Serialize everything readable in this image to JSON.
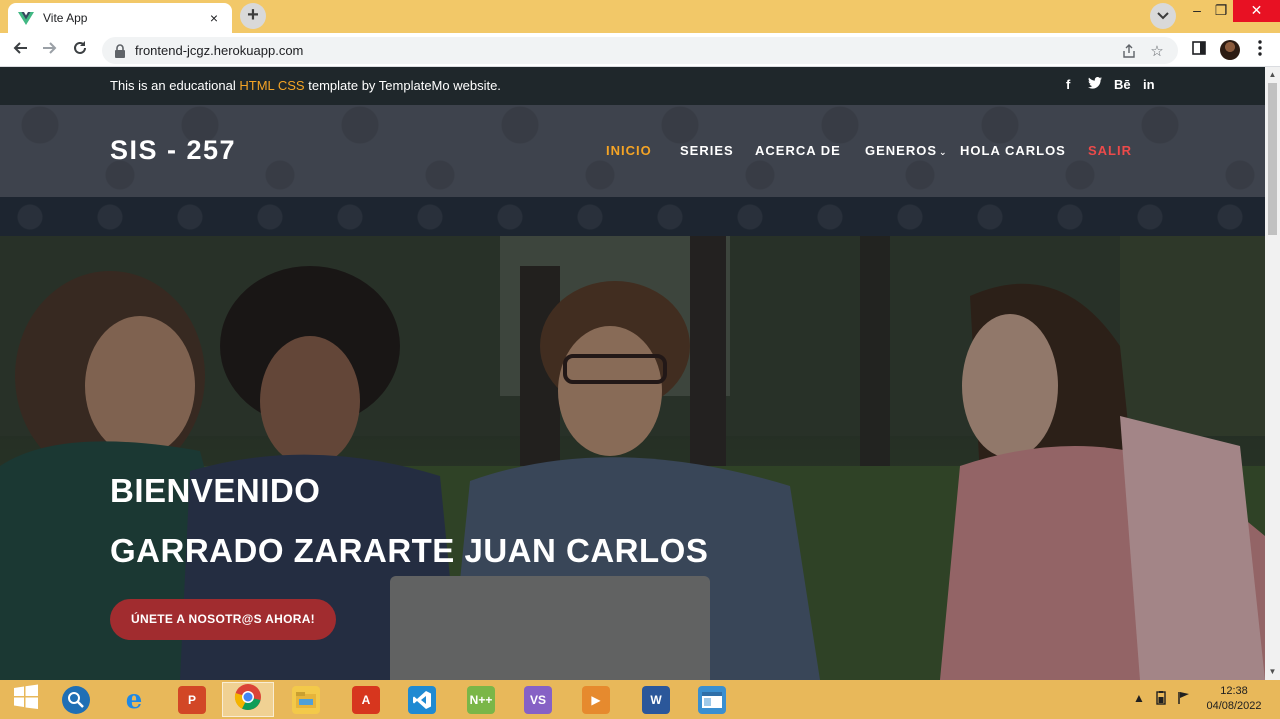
{
  "browser": {
    "tab_title": "Vite App",
    "tab_close": "×",
    "new_tab": "+",
    "url": "frontend-jcgz.herokuapp.com",
    "win_minimize": "–",
    "win_restore": "❐",
    "win_close": "✕"
  },
  "sub_header": {
    "text_before": "This is an educational ",
    "text_highlight": "HTML CSS",
    "text_after": " template by TemplateMo website.",
    "social": [
      "f",
      "t",
      "Bē",
      "in"
    ]
  },
  "header": {
    "logo": "SIS - 257",
    "nav": [
      {
        "label": "INICIO"
      },
      {
        "label": "SERIES"
      },
      {
        "label": "ACERCA DE"
      },
      {
        "label": "GENEROS"
      },
      {
        "label": "HOLA CARLOS"
      },
      {
        "label": "SALIR"
      }
    ],
    "caret": "⌄"
  },
  "hero": {
    "title_line1": "BIENVENIDO",
    "title_line2": "GARRADO ZARARTE JUAN CARLOS",
    "cta_label": "ÚNETE A NOSOTR@S AHORA!"
  },
  "taskbar": {
    "apps": [
      {
        "icon": "start-icon"
      },
      {
        "icon": "search-magnifier-icon"
      },
      {
        "icon": "internet-explorer-icon"
      },
      {
        "icon": "powerpoint-icon"
      },
      {
        "icon": "chrome-icon"
      },
      {
        "icon": "file-explorer-icon"
      },
      {
        "icon": "acrobat-icon"
      },
      {
        "icon": "vscode-icon"
      },
      {
        "icon": "notepadpp-icon"
      },
      {
        "icon": "visual-studio-icon"
      },
      {
        "icon": "media-player-icon"
      },
      {
        "icon": "word-icon"
      },
      {
        "icon": "window-app-icon"
      }
    ],
    "time": "12:38",
    "date": "04/08/2022"
  },
  "colors": {
    "accent_orange": "#f5a425",
    "logout_red": "#ec4a4a",
    "cta_red": "#a12c2f",
    "dark_bar": "#1f272b",
    "header_bg": "#3e434d"
  }
}
